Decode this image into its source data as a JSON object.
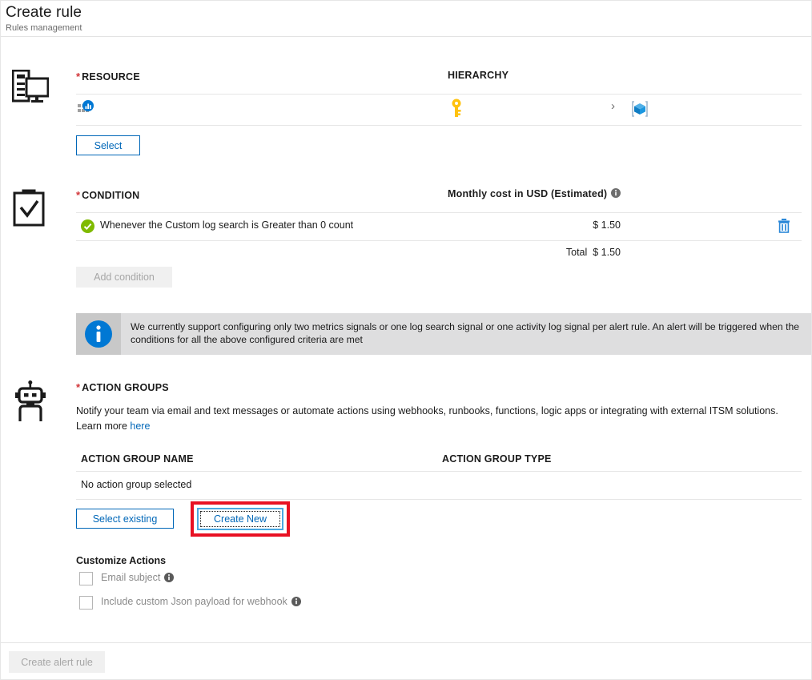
{
  "header": {
    "title": "Create rule",
    "subtitle": "Rules management"
  },
  "resource": {
    "icon": "server-monitor-icon",
    "label": "RESOURCE",
    "required": "*",
    "hierarchy_label": "HIERARCHY",
    "resource_icon": "log-analytics-workspace-icon",
    "hierarchy_key_icon": "subscription-key-icon",
    "hierarchy_separator": "›",
    "hierarchy_group_icon": "resource-group-cube-icon",
    "select_button": "Select"
  },
  "condition": {
    "icon": "clipboard-check-icon",
    "label": "CONDITION",
    "required": "*",
    "cost_header": "Monthly cost in USD (Estimated)",
    "cost_info_icon": "info-icon",
    "rows": [
      {
        "status_icon": "green-check-icon",
        "text": "Whenever the Custom log search is Greater than 0 count",
        "cost": "$ 1.50",
        "delete_icon": "trash-icon"
      }
    ],
    "total_label": "Total",
    "total_value": "$ 1.50",
    "add_condition_button": "Add condition"
  },
  "banner": {
    "icon": "info-circle-icon",
    "message": "We currently support configuring only two metrics signals or one log search signal or one activity log signal per alert rule. An alert will be triggered when the conditions for all the above configured criteria are met"
  },
  "action_groups": {
    "icon": "robot-icon",
    "label": "ACTION GROUPS",
    "required": "*",
    "description": "Notify your team via email and text messages or automate actions using webhooks, runbooks, functions, logic apps or integrating with external ITSM solutions.",
    "learn_more_prefix": "Learn more ",
    "learn_more_link": "here",
    "column_name": "ACTION GROUP NAME",
    "column_type": "ACTION GROUP TYPE",
    "empty_text": "No action group selected",
    "select_existing_button": "Select existing",
    "create_new_button": "Create New"
  },
  "customize_actions": {
    "title": "Customize Actions",
    "checkboxes": [
      {
        "label": "Email subject",
        "info_icon": "info-icon",
        "checked": false
      },
      {
        "label": "Include custom Json payload for webhook",
        "info_icon": "info-icon",
        "checked": false
      }
    ]
  },
  "footer": {
    "create_alert_rule_button": "Create alert rule"
  },
  "colors": {
    "accent_blue": "#0067b8",
    "required_red": "#d13438",
    "highlight_red": "#e81123",
    "focus_blue": "#4aa7e0",
    "success_green": "#7fba00",
    "banner_bg": "#dededf",
    "key_yellow": "#ffc20e"
  }
}
